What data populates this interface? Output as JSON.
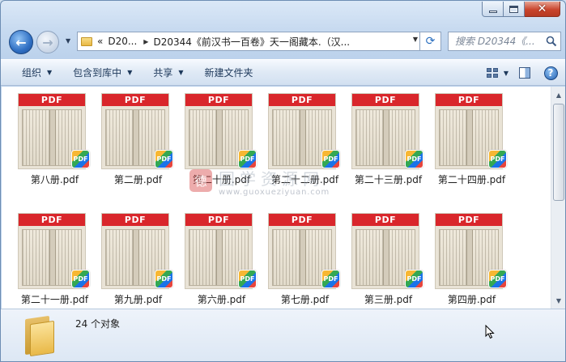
{
  "window": {
    "caption": {
      "min_label": "minimize",
      "max_label": "maximize",
      "close_glyph": "✕"
    }
  },
  "nav": {
    "back_glyph": "←",
    "forward_glyph": "→",
    "address": {
      "prefix": "«",
      "crumb_short": "D20...",
      "crumb_full": "D20344《前汉书一百卷》天一阁藏本.（汉..."
    },
    "refresh_glyph": "⟳",
    "search_placeholder": "搜索 D20344《..."
  },
  "toolbar": {
    "organize": "组织",
    "include_in_library": "包含到库中",
    "share": "共享",
    "new_folder": "新建文件夹"
  },
  "files": [
    {
      "name": "第八册.pdf",
      "thumb_label": "PDF",
      "badge": "PDF"
    },
    {
      "name": "第二册.pdf",
      "thumb_label": "PDF",
      "badge": "PDF"
    },
    {
      "name": "第二十册.pdf",
      "thumb_label": "PDF",
      "badge": "PDF"
    },
    {
      "name": "第二十二册.pdf",
      "thumb_label": "PDF",
      "badge": "PDF"
    },
    {
      "name": "第二十三册.pdf",
      "thumb_label": "PDF",
      "badge": "PDF"
    },
    {
      "name": "第二十四册.pdf",
      "thumb_label": "PDF",
      "badge": "PDF"
    },
    {
      "name": "第二十一册.pdf",
      "thumb_label": "PDF",
      "badge": "PDF"
    },
    {
      "name": "第九册.pdf",
      "thumb_label": "PDF",
      "badge": "PDF"
    },
    {
      "name": "第六册.pdf",
      "thumb_label": "PDF",
      "badge": "PDF"
    },
    {
      "name": "第七册.pdf",
      "thumb_label": "PDF",
      "badge": "PDF"
    },
    {
      "name": "第三册.pdf",
      "thumb_label": "PDF",
      "badge": "PDF"
    },
    {
      "name": "第四册.pdf",
      "thumb_label": "PDF",
      "badge": "PDF"
    }
  ],
  "watermark": {
    "logo": "德",
    "title": "国学资源网",
    "url": "www.guoxueziyuan.com"
  },
  "details": {
    "item_count": "24 个对象"
  },
  "colors": {
    "pdf_band": "#d9262b",
    "accent": "#2f6fc3",
    "close_button": "#c9452d"
  }
}
